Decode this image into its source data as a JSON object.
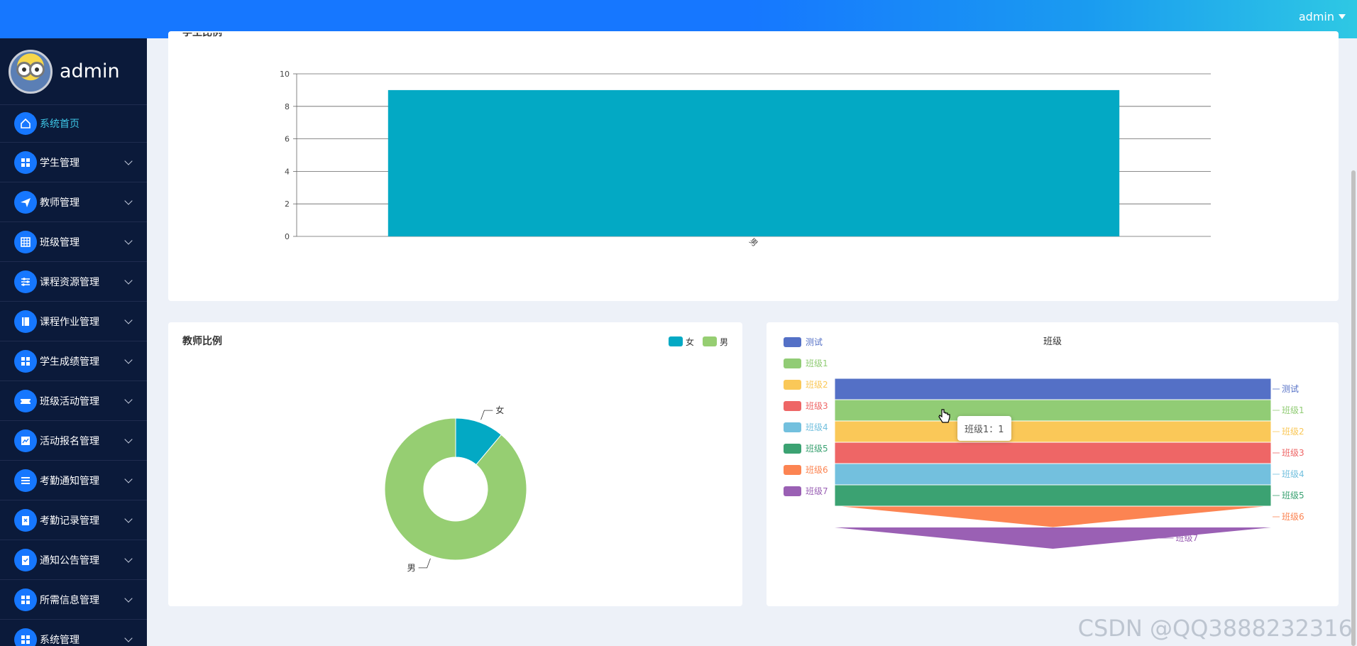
{
  "header": {
    "user_label": "admin"
  },
  "sidebar": {
    "admin_name": "admin",
    "items": [
      {
        "label": "系统首页",
        "icon": "home-icon",
        "active": true
      },
      {
        "label": "学生管理",
        "icon": "grid-icon"
      },
      {
        "label": "教师管理",
        "icon": "send-icon"
      },
      {
        "label": "班级管理",
        "icon": "table-icon"
      },
      {
        "label": "课程资源管理",
        "icon": "sliders-icon"
      },
      {
        "label": "课程作业管理",
        "icon": "book-icon"
      },
      {
        "label": "学生成绩管理",
        "icon": "grid-icon"
      },
      {
        "label": "班级活动管理",
        "icon": "ticket-icon"
      },
      {
        "label": "活动报名管理",
        "icon": "chart-icon"
      },
      {
        "label": "考勤通知管理",
        "icon": "list-icon"
      },
      {
        "label": "考勤记录管理",
        "icon": "clipboard-x-icon"
      },
      {
        "label": "通知公告管理",
        "icon": "clipboard-check-icon"
      },
      {
        "label": "所需信息管理",
        "icon": "grid-icon"
      },
      {
        "label": "系统管理",
        "icon": "grid-icon"
      }
    ]
  },
  "student_card": {
    "title": "学生比例"
  },
  "teacher_card": {
    "title": "教师比例"
  },
  "class_card": {
    "title": "班级"
  },
  "tooltip": {
    "text": "班级1：1"
  },
  "watermark": "CSDN @QQ3888232316",
  "colors": {
    "accent": "#1677ff",
    "sidebar_bg": "#0b1a3a",
    "bar": "#03a9c4",
    "female": "#03a9c4",
    "male": "#96ce72"
  },
  "chart_data": [
    {
      "type": "bar",
      "title": "学生比例",
      "categories": [
        "男"
      ],
      "values": [
        9
      ],
      "ylim": [
        0,
        10
      ],
      "yticks": [
        "0",
        "2",
        "4",
        "6",
        "8",
        "10"
      ]
    },
    {
      "type": "pie",
      "title": "教师比例",
      "legend": [
        "女",
        "男"
      ],
      "legend_position": "top-right",
      "slices": [
        {
          "name": "女",
          "value": 1,
          "color": "#03a9c4"
        },
        {
          "name": "男",
          "value": 8,
          "color": "#96ce72"
        }
      ]
    },
    {
      "type": "funnel",
      "title": "班级",
      "legend_position": "left",
      "stages": [
        {
          "name": "测试",
          "value": 1,
          "color": "#5470c6"
        },
        {
          "name": "班级1",
          "value": 1,
          "color": "#91cc75"
        },
        {
          "name": "班级2",
          "value": 1,
          "color": "#fac858"
        },
        {
          "name": "班级3",
          "value": 1,
          "color": "#ee6666"
        },
        {
          "name": "班级4",
          "value": 1,
          "color": "#73c0de"
        },
        {
          "name": "班级5",
          "value": 1,
          "color": "#3ba272"
        },
        {
          "name": "班级6",
          "value": 1,
          "color": "#fc8452"
        },
        {
          "name": "班级7",
          "value": 0,
          "color": "#9a60b4"
        }
      ]
    }
  ]
}
